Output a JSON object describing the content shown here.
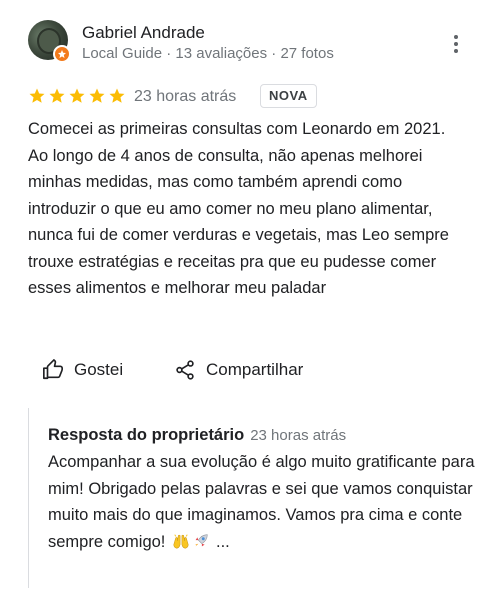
{
  "reviewer": {
    "name": "Gabriel Andrade",
    "meta": "Local Guide · 13 avaliações · 27 fotos"
  },
  "rating": {
    "stars": 5,
    "max": 5,
    "time": "23 horas atrás",
    "badge": "NOVA"
  },
  "review_text": "Comecei as primeiras consultas com Leonardo em 2021. Ao longo de 4 anos de consulta, não apenas melhorei minhas medidas, mas como também aprendi como introduzir o que eu amo comer no meu plano alimentar, nunca fui de comer verduras e vegetais, mas Leo sempre trouxe estratégias e receitas pra que eu pudesse comer esses alimentos e melhorar meu paladar",
  "actions": {
    "like_label": "Gostei",
    "share_label": "Compartilhar"
  },
  "owner_response": {
    "title": "Resposta do proprietário",
    "time": "23 horas atrás",
    "text": "Acompanhar a sua evolução é algo muito gratificante para mim! Obrigado pelas palavras e sei que vamos conquistar muito mais do que imaginamos. Vamos pra cima e conte sempre comigo!",
    "emojis": [
      "raising-hands-icon",
      "rocket-icon"
    ],
    "more": "..."
  },
  "colors": {
    "star": "#fbbc04",
    "secondary_text": "#70757a",
    "badge_orange": "#f37b1d"
  }
}
